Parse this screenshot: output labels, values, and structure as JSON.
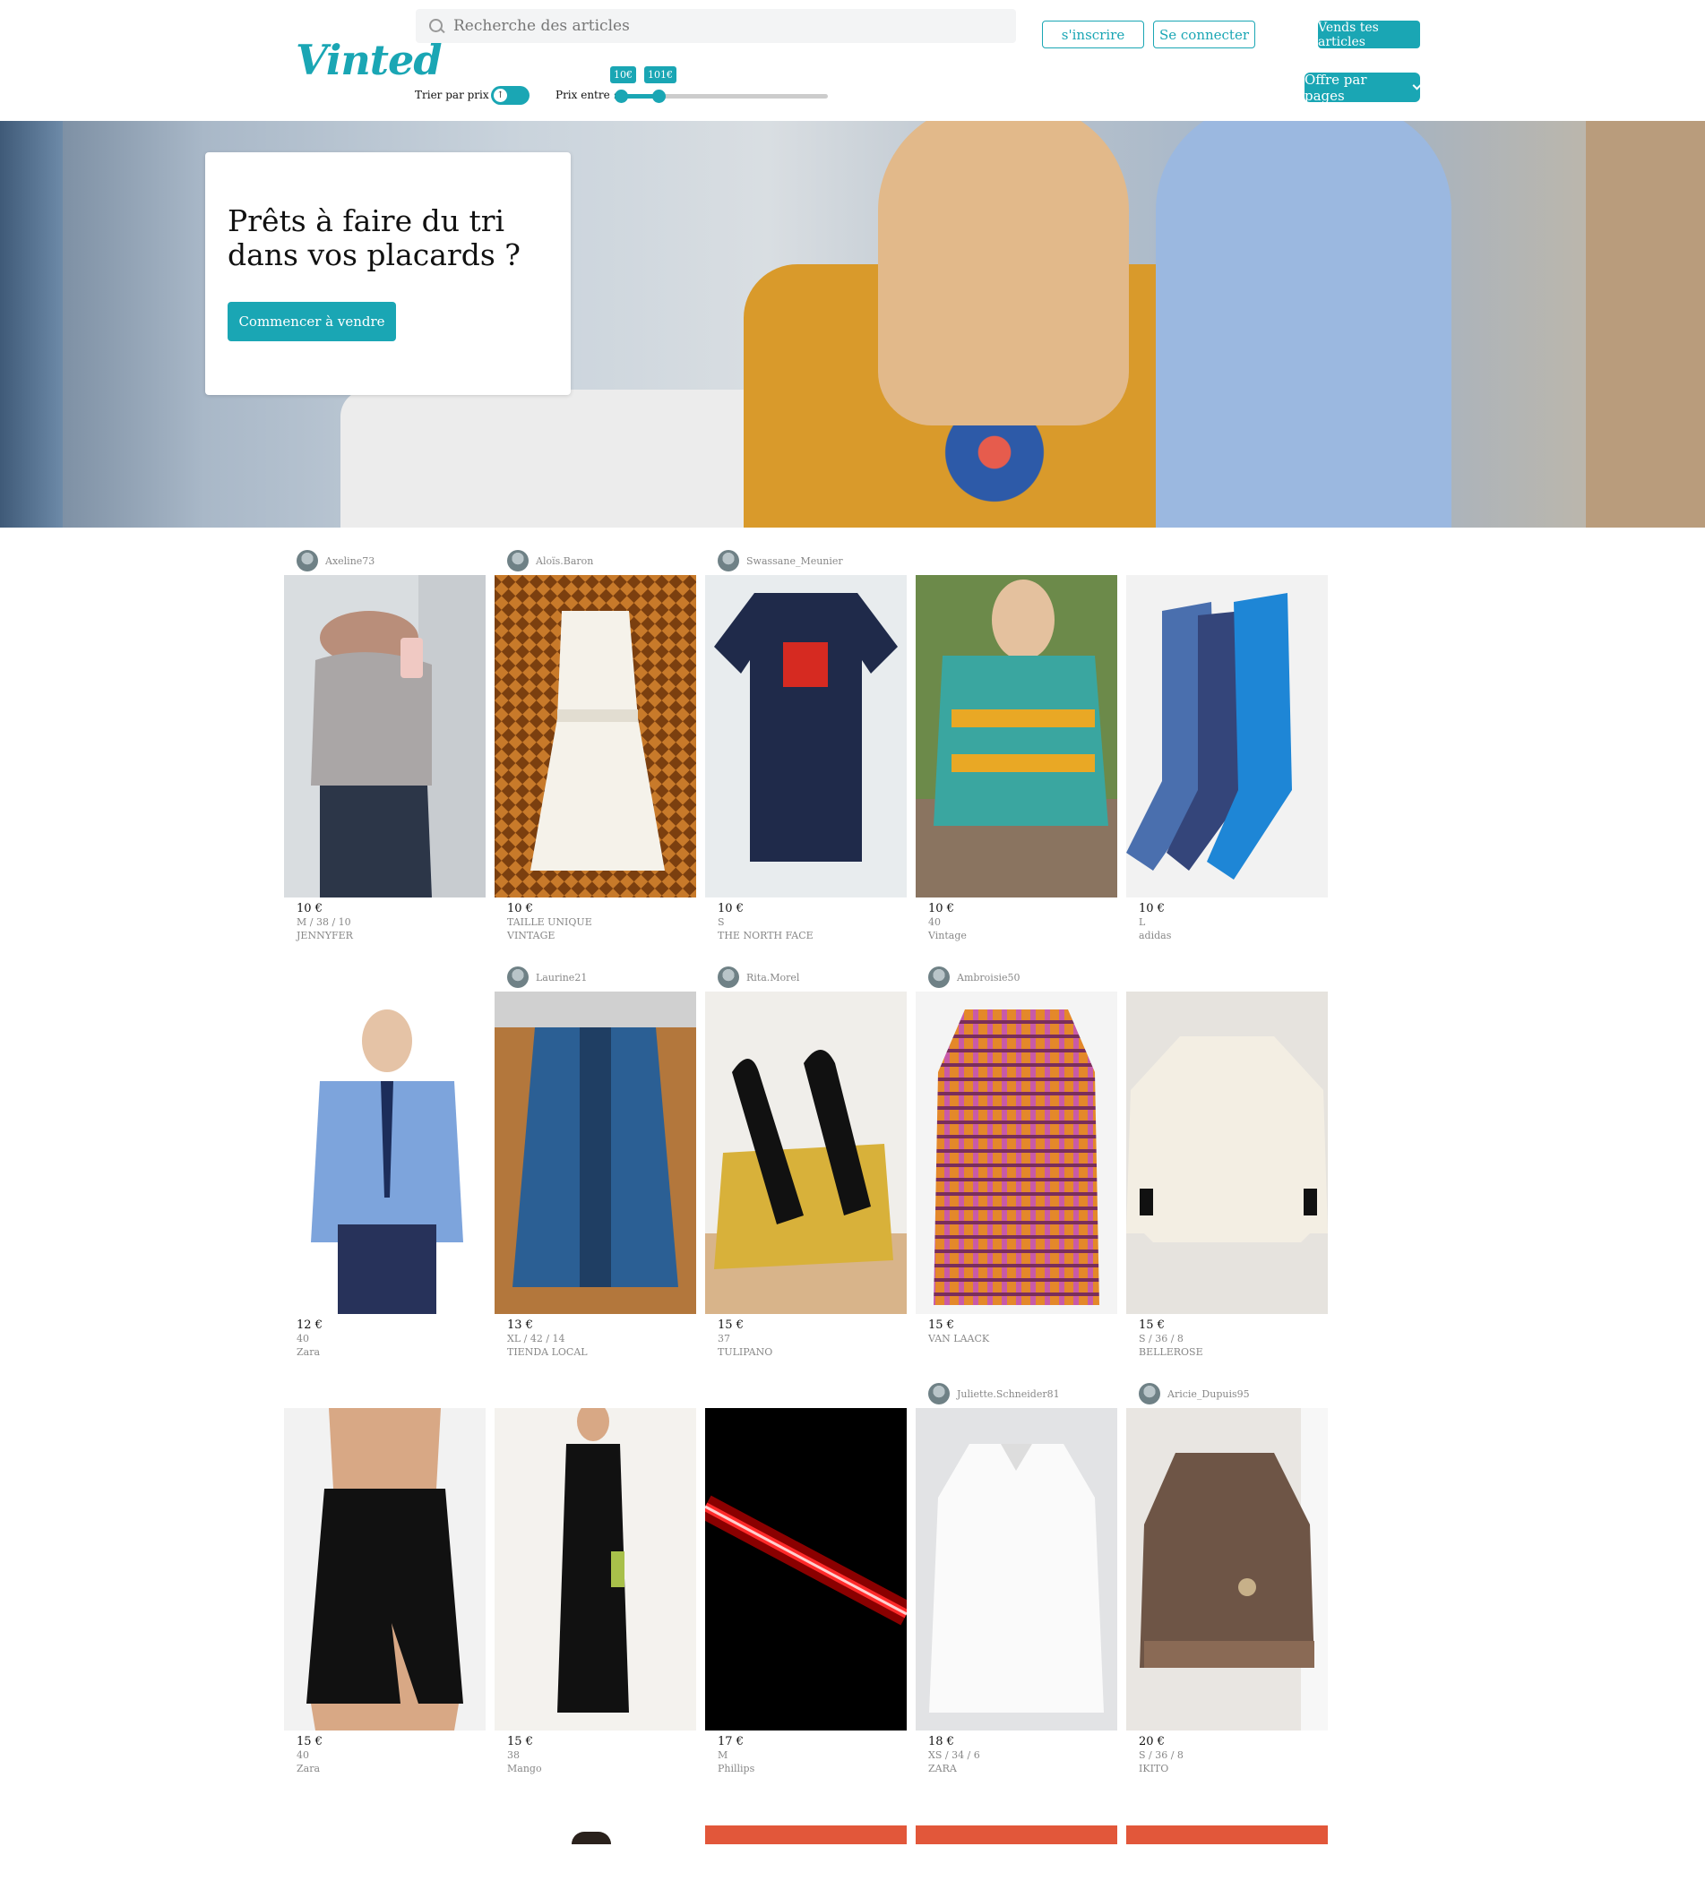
{
  "header": {
    "logo": "Vinted",
    "search_placeholder": "Recherche des articles",
    "signup_label": "s'inscrire",
    "login_label": "Se connecter",
    "sell_label": "Vends tes articles",
    "sort_label": "Trier par prix :",
    "toggle_glyph": "↑",
    "price_label": "Prix entre :",
    "price_min": "10€",
    "price_max": "101€",
    "offers_label": "Offre par pages",
    "accent_color": "#1aa6b4"
  },
  "hero": {
    "title": "Prêts à faire du tri dans vos placards ?",
    "cta_label": "Commencer à vendre"
  },
  "items": [
    {
      "user": "Axeline73",
      "price": "10 €",
      "size": "M / 38 / 10",
      "brand": "JENNYFER"
    },
    {
      "user": "Aloïs.Baron",
      "price": "10 €",
      "size": "TAILLE UNIQUE",
      "brand": "VINTAGE"
    },
    {
      "user": "Swassane_Meunier",
      "price": "10 €",
      "size": "S",
      "brand": "THE NORTH FACE"
    },
    {
      "user": "",
      "price": "10 €",
      "size": "40",
      "brand": "Vintage"
    },
    {
      "user": "",
      "price": "10 €",
      "size": "L",
      "brand": "adidas"
    },
    {
      "user": "",
      "price": "12 €",
      "size": "40",
      "brand": "Zara"
    },
    {
      "user": "Laurine21",
      "price": "13 €",
      "size": "XL / 42 / 14",
      "brand": "TIENDA LOCAL"
    },
    {
      "user": "Rita.Morel",
      "price": "15 €",
      "size": "37",
      "brand": "TULIPANO"
    },
    {
      "user": "Ambroisie50",
      "price": "15 €",
      "size": "",
      "brand": "VAN LAACK"
    },
    {
      "user": "",
      "price": "15 €",
      "size": "S / 36 / 8",
      "brand": "BELLEROSE"
    },
    {
      "user": "",
      "price": "15 €",
      "size": "40",
      "brand": "Zara"
    },
    {
      "user": "",
      "price": "15 €",
      "size": "38",
      "brand": "Mango"
    },
    {
      "user": "",
      "price": "17 €",
      "size": "M",
      "brand": "Phillips"
    },
    {
      "user": "Juliette.Schneider81",
      "price": "18 €",
      "size": "XS / 34 / 6",
      "brand": "ZARA"
    },
    {
      "user": "Aricie_Dupuis95",
      "price": "20 €",
      "size": "S / 36 / 8",
      "brand": "IKITO"
    }
  ]
}
